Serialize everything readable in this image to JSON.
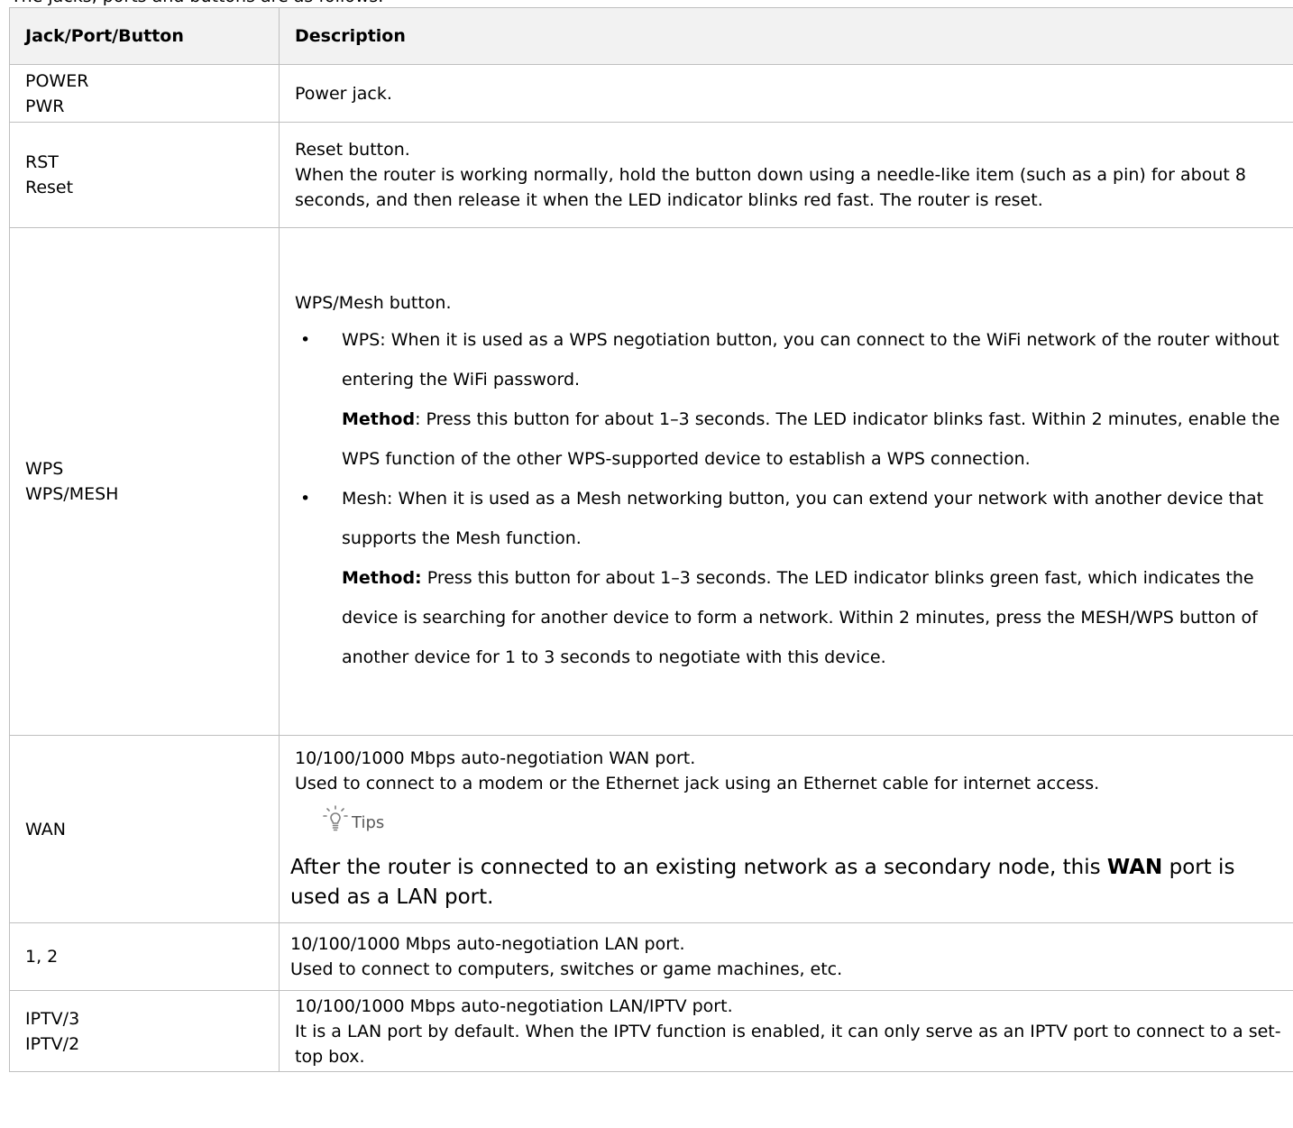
{
  "caption_partial": "The jacks, ports and buttons are as follows.",
  "table": {
    "headers": [
      "Jack/Port/Button",
      "Description"
    ],
    "rows": [
      {
        "name": [
          "POWER",
          "PWR"
        ],
        "desc": "Power jack."
      },
      {
        "name": [
          "RST",
          "Reset"
        ],
        "desc_title": "Reset button.",
        "desc_body": "When the router is working normally, hold the button down using a needle-like item (such as a pin) for about 8 seconds, and then release it when the LED indicator blinks red fast. The router is reset."
      },
      {
        "name": [
          "WPS",
          "WPS/MESH"
        ],
        "desc_title": "WPS/Mesh button.",
        "bullets": [
          {
            "text": "WPS: When it is used as a WPS negotiation button, you can connect to the WiFi network of the router without entering the WiFi password.",
            "method_label": "Method",
            "method_text": ": Press this button for about 1–3 seconds. The LED indicator blinks fast. Within 2 minutes, enable the WPS function of the other WPS-supported device to establish a WPS connection."
          },
          {
            "text": "Mesh: When it is used as a Mesh networking button, you can extend your network with another device that supports the Mesh function.",
            "method_label": "Method:",
            "method_text": " Press this button for about 1–3 seconds. The LED indicator blinks green fast, which indicates the device is searching for another device to form a network. Within 2 minutes, press the MESH/WPS button of another device for 1 to 3 seconds to negotiate with this device."
          }
        ]
      },
      {
        "name": [
          "WAN"
        ],
        "desc_title": "10/100/1000 Mbps auto-negotiation WAN port.",
        "desc_body": "Used to connect to a modem or the Ethernet jack using an Ethernet cable for internet access.",
        "tips_label": "Tips",
        "tip_pre": "After the router is connected to an existing network as a secondary node, this ",
        "tip_bold": "WAN",
        "tip_post": " port is used as a LAN port."
      },
      {
        "name": [
          "1, 2"
        ],
        "desc_title": "10/100/1000 Mbps auto-negotiation LAN port.",
        "desc_body": "Used to connect to computers, switches or game machines, etc."
      },
      {
        "name": [
          "IPTV/3",
          "IPTV/2"
        ],
        "desc_title": "10/100/1000 Mbps auto-negotiation LAN/IPTV port.",
        "desc_body": "It is a LAN port by default. When the IPTV function is enabled, it can only serve as an IPTV port to connect to a set-top box."
      }
    ]
  }
}
